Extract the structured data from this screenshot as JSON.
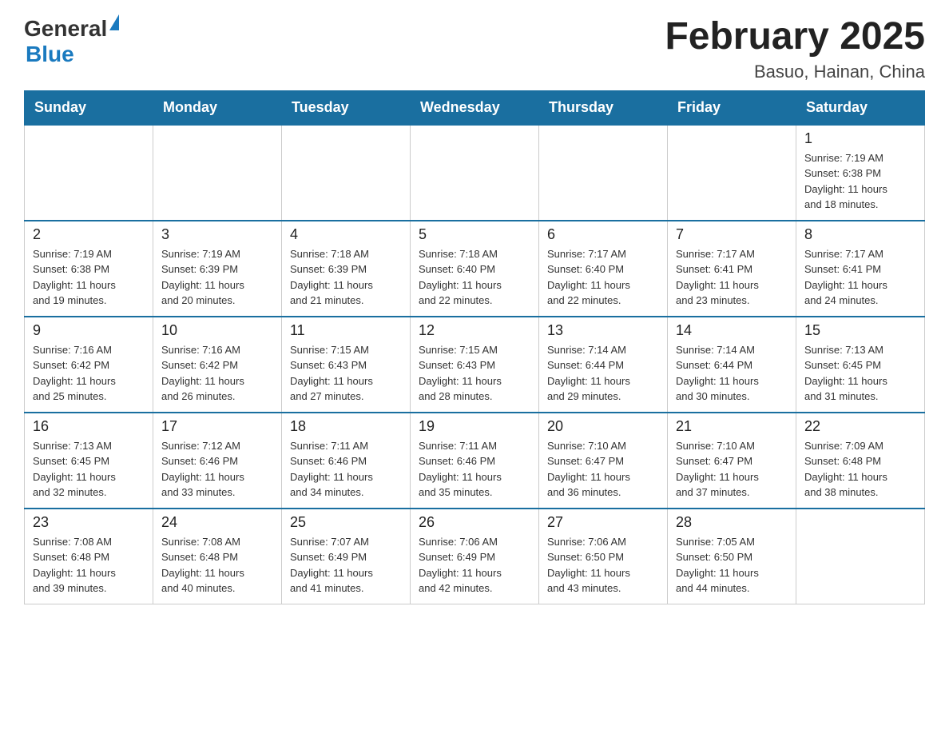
{
  "header": {
    "logo_general": "General",
    "logo_blue": "Blue",
    "month_title": "February 2025",
    "location": "Basuo, Hainan, China"
  },
  "days_of_week": [
    "Sunday",
    "Monday",
    "Tuesday",
    "Wednesday",
    "Thursday",
    "Friday",
    "Saturday"
  ],
  "weeks": [
    {
      "cells": [
        {
          "date": "",
          "info": ""
        },
        {
          "date": "",
          "info": ""
        },
        {
          "date": "",
          "info": ""
        },
        {
          "date": "",
          "info": ""
        },
        {
          "date": "",
          "info": ""
        },
        {
          "date": "",
          "info": ""
        },
        {
          "date": "1",
          "info": "Sunrise: 7:19 AM\nSunset: 6:38 PM\nDaylight: 11 hours\nand 18 minutes."
        }
      ]
    },
    {
      "cells": [
        {
          "date": "2",
          "info": "Sunrise: 7:19 AM\nSunset: 6:38 PM\nDaylight: 11 hours\nand 19 minutes."
        },
        {
          "date": "3",
          "info": "Sunrise: 7:19 AM\nSunset: 6:39 PM\nDaylight: 11 hours\nand 20 minutes."
        },
        {
          "date": "4",
          "info": "Sunrise: 7:18 AM\nSunset: 6:39 PM\nDaylight: 11 hours\nand 21 minutes."
        },
        {
          "date": "5",
          "info": "Sunrise: 7:18 AM\nSunset: 6:40 PM\nDaylight: 11 hours\nand 22 minutes."
        },
        {
          "date": "6",
          "info": "Sunrise: 7:17 AM\nSunset: 6:40 PM\nDaylight: 11 hours\nand 22 minutes."
        },
        {
          "date": "7",
          "info": "Sunrise: 7:17 AM\nSunset: 6:41 PM\nDaylight: 11 hours\nand 23 minutes."
        },
        {
          "date": "8",
          "info": "Sunrise: 7:17 AM\nSunset: 6:41 PM\nDaylight: 11 hours\nand 24 minutes."
        }
      ]
    },
    {
      "cells": [
        {
          "date": "9",
          "info": "Sunrise: 7:16 AM\nSunset: 6:42 PM\nDaylight: 11 hours\nand 25 minutes."
        },
        {
          "date": "10",
          "info": "Sunrise: 7:16 AM\nSunset: 6:42 PM\nDaylight: 11 hours\nand 26 minutes."
        },
        {
          "date": "11",
          "info": "Sunrise: 7:15 AM\nSunset: 6:43 PM\nDaylight: 11 hours\nand 27 minutes."
        },
        {
          "date": "12",
          "info": "Sunrise: 7:15 AM\nSunset: 6:43 PM\nDaylight: 11 hours\nand 28 minutes."
        },
        {
          "date": "13",
          "info": "Sunrise: 7:14 AM\nSunset: 6:44 PM\nDaylight: 11 hours\nand 29 minutes."
        },
        {
          "date": "14",
          "info": "Sunrise: 7:14 AM\nSunset: 6:44 PM\nDaylight: 11 hours\nand 30 minutes."
        },
        {
          "date": "15",
          "info": "Sunrise: 7:13 AM\nSunset: 6:45 PM\nDaylight: 11 hours\nand 31 minutes."
        }
      ]
    },
    {
      "cells": [
        {
          "date": "16",
          "info": "Sunrise: 7:13 AM\nSunset: 6:45 PM\nDaylight: 11 hours\nand 32 minutes."
        },
        {
          "date": "17",
          "info": "Sunrise: 7:12 AM\nSunset: 6:46 PM\nDaylight: 11 hours\nand 33 minutes."
        },
        {
          "date": "18",
          "info": "Sunrise: 7:11 AM\nSunset: 6:46 PM\nDaylight: 11 hours\nand 34 minutes."
        },
        {
          "date": "19",
          "info": "Sunrise: 7:11 AM\nSunset: 6:46 PM\nDaylight: 11 hours\nand 35 minutes."
        },
        {
          "date": "20",
          "info": "Sunrise: 7:10 AM\nSunset: 6:47 PM\nDaylight: 11 hours\nand 36 minutes."
        },
        {
          "date": "21",
          "info": "Sunrise: 7:10 AM\nSunset: 6:47 PM\nDaylight: 11 hours\nand 37 minutes."
        },
        {
          "date": "22",
          "info": "Sunrise: 7:09 AM\nSunset: 6:48 PM\nDaylight: 11 hours\nand 38 minutes."
        }
      ]
    },
    {
      "cells": [
        {
          "date": "23",
          "info": "Sunrise: 7:08 AM\nSunset: 6:48 PM\nDaylight: 11 hours\nand 39 minutes."
        },
        {
          "date": "24",
          "info": "Sunrise: 7:08 AM\nSunset: 6:48 PM\nDaylight: 11 hours\nand 40 minutes."
        },
        {
          "date": "25",
          "info": "Sunrise: 7:07 AM\nSunset: 6:49 PM\nDaylight: 11 hours\nand 41 minutes."
        },
        {
          "date": "26",
          "info": "Sunrise: 7:06 AM\nSunset: 6:49 PM\nDaylight: 11 hours\nand 42 minutes."
        },
        {
          "date": "27",
          "info": "Sunrise: 7:06 AM\nSunset: 6:50 PM\nDaylight: 11 hours\nand 43 minutes."
        },
        {
          "date": "28",
          "info": "Sunrise: 7:05 AM\nSunset: 6:50 PM\nDaylight: 11 hours\nand 44 minutes."
        },
        {
          "date": "",
          "info": ""
        }
      ]
    }
  ]
}
